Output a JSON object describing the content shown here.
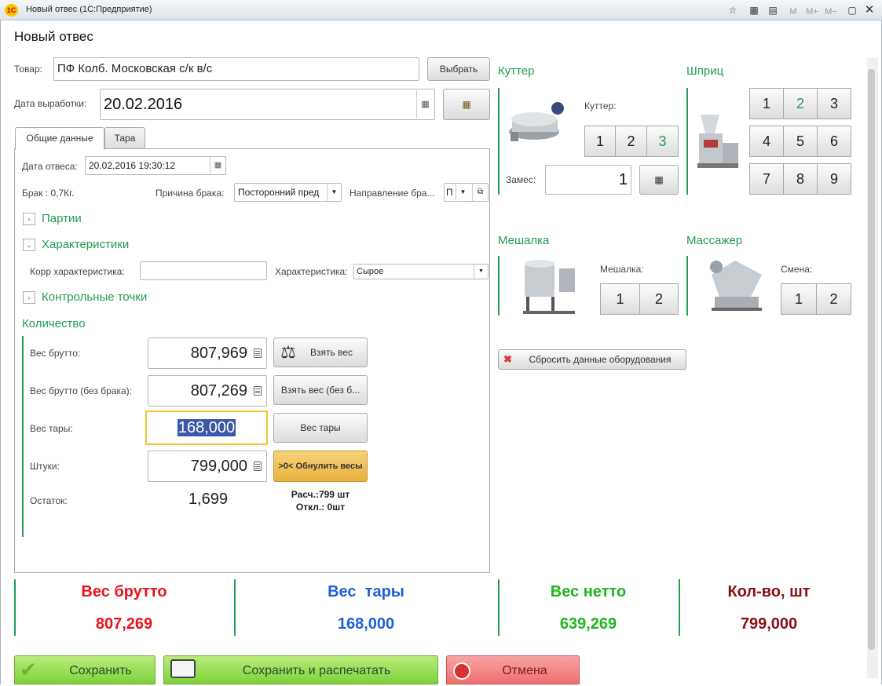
{
  "window": {
    "title": "Новый отвес  (1С:Предприятие)",
    "logo": "1С",
    "tb_m": "M",
    "tb_mplus": "M+",
    "tb_mminus": "M−"
  },
  "form": {
    "title": "Новый отвес"
  },
  "product": {
    "label": "Товар:",
    "value": "ПФ Колб. Московская с/к в/с",
    "select_btn": "Выбрать"
  },
  "date_made": {
    "label": "Дата выработки:",
    "value": "20.02.2016"
  },
  "tabs": [
    {
      "label": "Общие данные"
    },
    {
      "label": "Тара"
    }
  ],
  "general": {
    "weigh_date_label": "Дата отвеса:",
    "weigh_date_value": "20.02.2016 19:30:12",
    "defect_label": "Брак : 0,7Кг.",
    "defect_reason_label": "Причина брака:",
    "defect_reason_value": "Посторонний пред",
    "defect_dir_label": "Направление бра...",
    "defect_dir_value": "П",
    "section_batches": "Партии",
    "section_characteristics": "Характеристики",
    "corr_char_label": "Корр характеристика:",
    "corr_char_value": "",
    "char_label": "Характеристика:",
    "char_value": "Сырое",
    "section_control": "Контрольные точки"
  },
  "quantity": {
    "title": "Количество",
    "gross_label": "Вес брутто:",
    "gross_value": "807,969",
    "take_weight_btn": "Взять вес",
    "gross_nodef_label": "Вес брутто (без брака):",
    "gross_nodef_value": "807,269",
    "take_weight_nodef_btn": "Взять вес (без б...",
    "tare_label": "Вес тары:",
    "tare_value": "168,000",
    "tare_btn": "Вес тары",
    "pieces_label": "Штуки:",
    "pieces_value": "799,000",
    "zero_btn": ">0< Обнулить весы",
    "rest_label": "Остаток:",
    "rest_value": "1,699",
    "calc_text": "Расч.:799 шт",
    "dev_text": "Откл.: 0шт"
  },
  "equipment": {
    "cutter": {
      "title": "Куттер",
      "label": "Куттер:",
      "buttons": [
        "1",
        "2",
        "3"
      ],
      "selected": "3",
      "batch_label": "Замес:",
      "batch_value": "1"
    },
    "syringe": {
      "title": "Шприц",
      "buttons": [
        "1",
        "2",
        "3",
        "4",
        "5",
        "6",
        "7",
        "8",
        "9"
      ],
      "selected": "2"
    },
    "mixer": {
      "title": "Мешалка",
      "label": "Мешалка:",
      "buttons": [
        "1",
        "2"
      ]
    },
    "massager": {
      "title": "Массажер",
      "label": "Смена:",
      "buttons": [
        "1",
        "2"
      ]
    },
    "reset_btn": "Сбросить данные оборудования"
  },
  "summary": [
    {
      "title": "Вес брутто",
      "value": "807,269",
      "color": "#e8141a"
    },
    {
      "title": "Вес  тары",
      "value": "168,000",
      "color": "#1f5fd6"
    },
    {
      "title": "Вес нетто",
      "value": "639,269",
      "color": "#1fb520"
    },
    {
      "title": "Кол-во, шт",
      "value": "799,000",
      "color": "#8a0e12"
    }
  ],
  "actions": {
    "save": "Сохранить",
    "save_print": "Сохранить и распечатать",
    "cancel": "Отмена"
  }
}
